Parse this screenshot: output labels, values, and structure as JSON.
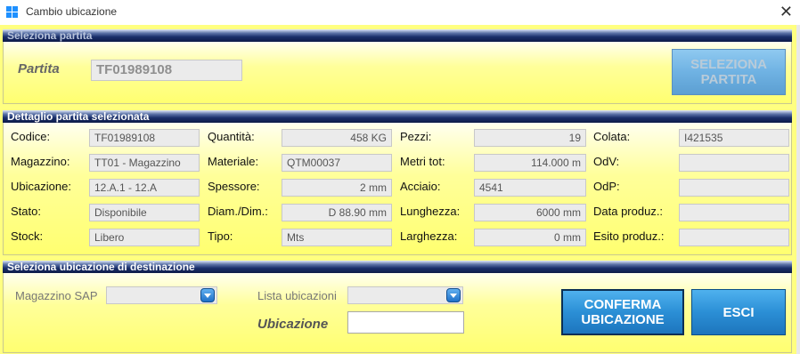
{
  "window": {
    "title": "Cambio ubicazione",
    "close_glyph": "✕"
  },
  "section1": {
    "header": "Seleziona partita",
    "partita_label": "Partita",
    "partita_value": "TF01989108",
    "select_button": [
      "SELEZIONA",
      "PARTITA"
    ]
  },
  "section2": {
    "header": "Dettaglio partita selezionata",
    "col1": [
      {
        "label": "Codice:",
        "value": "TF01989108"
      },
      {
        "label": "Magazzino:",
        "value": "TT01 - Magazzino"
      },
      {
        "label": "Ubicazione:",
        "value": "12.A.1 - 12.A"
      },
      {
        "label": "Stato:",
        "value": "Disponibile"
      },
      {
        "label": "Stock:",
        "value": "Libero"
      }
    ],
    "col2": [
      {
        "label": "Quantità:",
        "value": "458 KG"
      },
      {
        "label": "Materiale:",
        "value": "QTM00037"
      },
      {
        "label": "Spessore:",
        "value": "2 mm"
      },
      {
        "label": "Diam./Dim.:",
        "value": "D 88.90 mm"
      },
      {
        "label": "Tipo:",
        "value": "Mts"
      }
    ],
    "col3": [
      {
        "label": "Pezzi:",
        "value": "19"
      },
      {
        "label": "Metri tot:",
        "value": "114.000 m"
      },
      {
        "label": "Acciaio:",
        "value": "4541"
      },
      {
        "label": "Lunghezza:",
        "value": "6000 mm"
      },
      {
        "label": "Larghezza:",
        "value": "0 mm"
      }
    ],
    "col4": [
      {
        "label": "Colata:",
        "value": "I421535"
      },
      {
        "label": "OdV:",
        "value": ""
      },
      {
        "label": "OdP:",
        "value": ""
      },
      {
        "label": "Data produz.:",
        "value": ""
      },
      {
        "label": "Esito produz.:",
        "value": ""
      }
    ]
  },
  "section3": {
    "header": "Seleziona ubicazione di destinazione",
    "magazzino_label": "Magazzino SAP",
    "magazzino_value": "",
    "lista_label": "Lista ubicazioni",
    "lista_value": "",
    "ubicazione_label": "Ubicazione",
    "ubicazione_value": "",
    "confirm_button": [
      "CONFERMA",
      "UBICAZIONE"
    ],
    "exit_button": "ESCI"
  },
  "colors": {
    "background": "#ffff80",
    "header": "#0d1b48",
    "button": "#2b8fd6"
  }
}
